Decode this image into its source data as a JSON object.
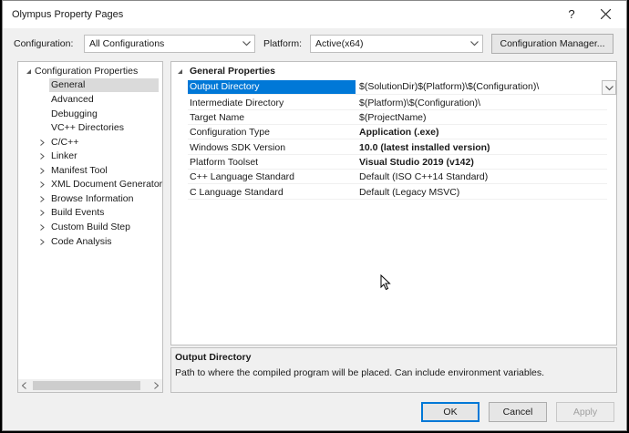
{
  "window": {
    "title": "Olympus Property Pages",
    "help_label": "?"
  },
  "config": {
    "configuration_label": "Configuration:",
    "configuration_value": "All Configurations",
    "platform_label": "Platform:",
    "platform_value": "Active(x64)",
    "manager_button": "Configuration Manager..."
  },
  "tree": {
    "root": "Configuration Properties",
    "items": [
      {
        "label": "General",
        "selected": true
      },
      {
        "label": "Advanced"
      },
      {
        "label": "Debugging"
      },
      {
        "label": "VC++ Directories"
      },
      {
        "label": "C/C++"
      },
      {
        "label": "Linker"
      },
      {
        "label": "Manifest Tool"
      },
      {
        "label": "XML Document Generator"
      },
      {
        "label": "Browse Information"
      },
      {
        "label": "Build Events"
      },
      {
        "label": "Custom Build Step"
      },
      {
        "label": "Code Analysis"
      }
    ]
  },
  "grid": {
    "category": "General Properties",
    "rows": [
      {
        "name": "Output Directory",
        "value": "$(SolutionDir)$(Platform)\\$(Configuration)\\"
      },
      {
        "name": "Intermediate Directory",
        "value": "$(Platform)\\$(Configuration)\\"
      },
      {
        "name": "Target Name",
        "value": "$(ProjectName)"
      },
      {
        "name": "Configuration Type",
        "value": "Application (.exe)"
      },
      {
        "name": "Windows SDK Version",
        "value": "10.0 (latest installed version)"
      },
      {
        "name": "Platform Toolset",
        "value": "Visual Studio 2019 (v142)"
      },
      {
        "name": "C++ Language Standard",
        "value": "Default (ISO C++14 Standard)"
      },
      {
        "name": "C Language Standard",
        "value": "Default (Legacy MSVC)"
      }
    ]
  },
  "description": {
    "title": "Output Directory",
    "text": "Path to where the compiled program will be placed. Can include environment variables."
  },
  "buttons": {
    "ok": "OK",
    "cancel": "Cancel",
    "apply": "Apply"
  }
}
